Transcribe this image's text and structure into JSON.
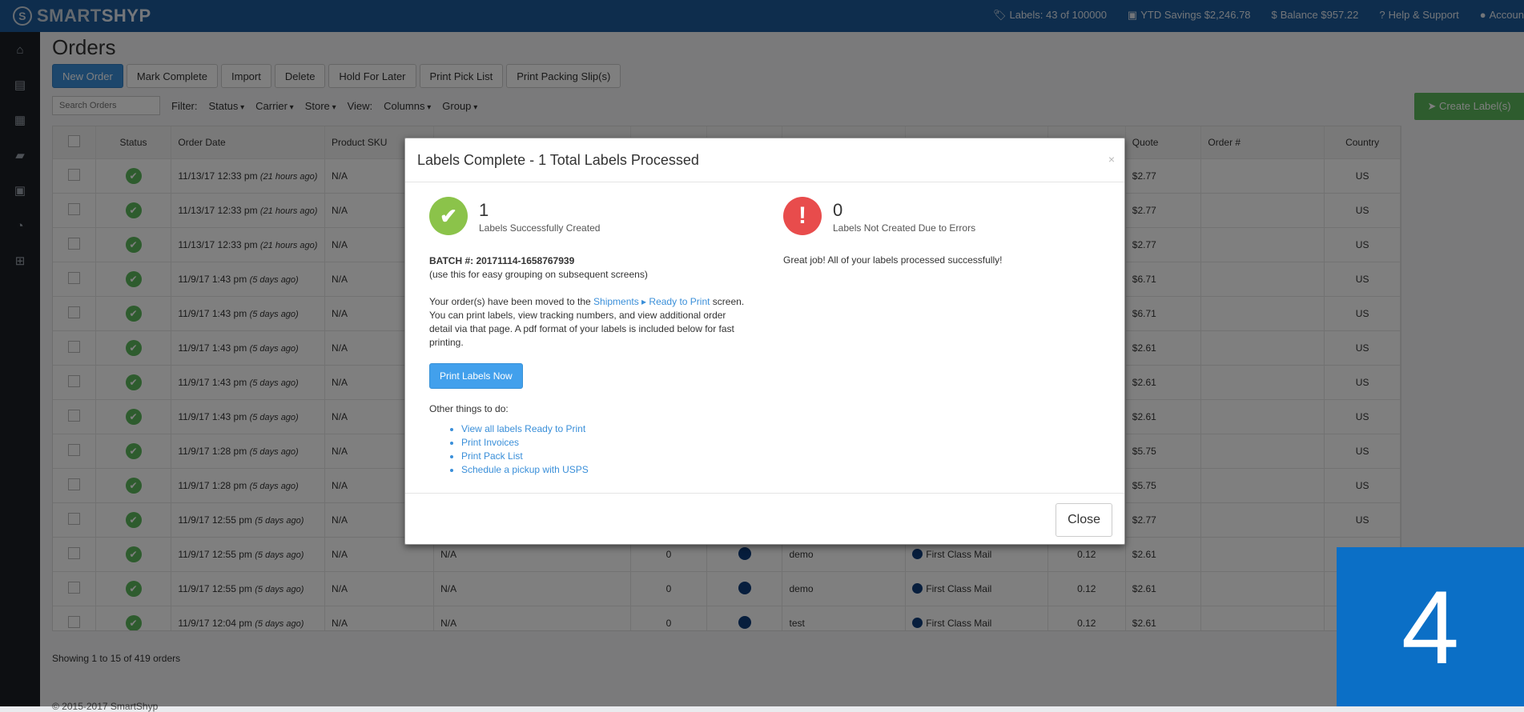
{
  "brand": {
    "part1": "SMART",
    "part2": "SHYP",
    "logo_icon": "S"
  },
  "top_stats": [
    {
      "icon": "tag-icon",
      "glyph": "🏷",
      "text": "Labels: 43 of 100000"
    },
    {
      "icon": "savings-icon",
      "glyph": "▣",
      "text": "YTD Savings $2,246.78"
    },
    {
      "icon": "dollar-icon",
      "glyph": "$",
      "text": "Balance $957.22"
    },
    {
      "icon": "help-icon",
      "glyph": "?",
      "text": "Help & Support"
    },
    {
      "icon": "account-icon",
      "glyph": "●",
      "text": "Accoun"
    }
  ],
  "left_nav": [
    {
      "name": "home-icon",
      "glyph": "⌂"
    },
    {
      "name": "basket-icon",
      "glyph": "▤"
    },
    {
      "name": "calendar-icon",
      "glyph": "▦"
    },
    {
      "name": "truck-icon",
      "glyph": "▰"
    },
    {
      "name": "contact-icon",
      "glyph": "▣"
    },
    {
      "name": "pie-chart-icon",
      "glyph": "◔"
    },
    {
      "name": "cart-icon",
      "glyph": "⊞"
    }
  ],
  "page": {
    "title": "Orders"
  },
  "actions": {
    "new_order": "New Order",
    "mark_complete": "Mark Complete",
    "import": "Import",
    "delete": "Delete",
    "hold": "Hold For Later",
    "pick_list": "Print Pick List",
    "packing_slips": "Print Packing Slip(s)"
  },
  "filters": {
    "search_placeholder": "Search Orders",
    "filter_label": "Filter:",
    "status": "Status",
    "carrier": "Carrier",
    "store": "Store",
    "view_label": "View:",
    "columns": "Columns",
    "group": "Group"
  },
  "create_label": "Create Label(s)",
  "table": {
    "headers": [
      "Status",
      "Order Date",
      "Product SKU",
      "",
      "",
      "",
      "",
      "",
      "Quote",
      "Order #",
      "Country"
    ],
    "rows": [
      {
        "date": "11/13/17 12:33 pm",
        "ago": "(21 hours ago)",
        "sku": "N/A",
        "col4": "",
        "col5": "",
        "store": "",
        "service": "",
        "weight": "",
        "quote": "$2.77",
        "country": "US"
      },
      {
        "date": "11/13/17 12:33 pm",
        "ago": "(21 hours ago)",
        "sku": "N/A",
        "col4": "",
        "col5": "",
        "store": "",
        "service": "",
        "weight": "",
        "quote": "$2.77",
        "country": "US"
      },
      {
        "date": "11/13/17 12:33 pm",
        "ago": "(21 hours ago)",
        "sku": "N/A",
        "col4": "",
        "col5": "",
        "store": "",
        "service": "",
        "weight": "",
        "quote": "$2.77",
        "country": "US"
      },
      {
        "date": "11/9/17 1:43 pm",
        "ago": "(5 days ago)",
        "sku": "N/A",
        "col4": "",
        "col5": "",
        "store": "",
        "service": "",
        "weight": "",
        "quote": "$6.71",
        "country": "US"
      },
      {
        "date": "11/9/17 1:43 pm",
        "ago": "(5 days ago)",
        "sku": "N/A",
        "col4": "",
        "col5": "",
        "store": "",
        "service": "",
        "weight": "",
        "quote": "$6.71",
        "country": "US"
      },
      {
        "date": "11/9/17 1:43 pm",
        "ago": "(5 days ago)",
        "sku": "N/A",
        "col4": "",
        "col5": "",
        "store": "",
        "service": "",
        "weight": "",
        "quote": "$2.61",
        "country": "US"
      },
      {
        "date": "11/9/17 1:43 pm",
        "ago": "(5 days ago)",
        "sku": "N/A",
        "col4": "",
        "col5": "",
        "store": "",
        "service": "",
        "weight": "",
        "quote": "$2.61",
        "country": "US"
      },
      {
        "date": "11/9/17 1:43 pm",
        "ago": "(5 days ago)",
        "sku": "N/A",
        "col4": "",
        "col5": "",
        "store": "",
        "service": "",
        "weight": "",
        "quote": "$2.61",
        "country": "US"
      },
      {
        "date": "11/9/17 1:28 pm",
        "ago": "(5 days ago)",
        "sku": "N/A",
        "col4": "",
        "col5": "",
        "store": "",
        "service": "",
        "weight": "",
        "quote": "$5.75",
        "country": "US"
      },
      {
        "date": "11/9/17 1:28 pm",
        "ago": "(5 days ago)",
        "sku": "N/A",
        "col4": "",
        "col5": "",
        "store": "",
        "service": "",
        "weight": "",
        "quote": "$5.75",
        "country": "US"
      },
      {
        "date": "11/9/17 12:55 pm",
        "ago": "(5 days ago)",
        "sku": "N/A",
        "col4": "",
        "col5": "",
        "store": "",
        "service": "",
        "weight": "",
        "quote": "$2.77",
        "country": "US"
      },
      {
        "date": "11/9/17 12:55 pm",
        "ago": "(5 days ago)",
        "sku": "N/A",
        "col4": "N/A",
        "col5": "0",
        "store": "demo",
        "service": "First Class Mail",
        "weight": "0.12",
        "quote": "$2.61",
        "country": "US"
      },
      {
        "date": "11/9/17 12:55 pm",
        "ago": "(5 days ago)",
        "sku": "N/A",
        "col4": "N/A",
        "col5": "0",
        "store": "demo",
        "service": "First Class Mail",
        "weight": "0.12",
        "quote": "$2.61",
        "country": ""
      },
      {
        "date": "11/9/17 12:04 pm",
        "ago": "(5 days ago)",
        "sku": "N/A",
        "col4": "N/A",
        "col5": "0",
        "store": "test",
        "service": "First Class Mail",
        "weight": "0.12",
        "quote": "$2.61",
        "country": ""
      }
    ]
  },
  "footer": {
    "showing": "Showing 1 to 15 of 419 orders",
    "copyright": "© 2015-2017 SmartShyp"
  },
  "modal": {
    "title": "Labels Complete - 1 Total Labels Processed",
    "close_x": "×",
    "success": {
      "count": "1",
      "label": "Labels Successfully Created",
      "icon": "✔"
    },
    "errors": {
      "count": "0",
      "label": "Labels Not Created Due to Errors",
      "icon": "!"
    },
    "batch_label": "BATCH #:",
    "batch_value": "20171114-1658767939",
    "batch_note": "(use this for easy grouping on subsequent screens)",
    "moved_pre": "Your order(s) have been moved to the ",
    "moved_link1": "Shipments",
    "moved_link2": "Ready to Print",
    "moved_post": " screen. You can print labels, view tracking numbers, and view additional order detail via that page. A pdf format of your labels is included below for fast printing.",
    "print_button": "Print Labels Now",
    "other_title": "Other things to do:",
    "other_links": [
      "View all labels Ready to Print",
      "Print Invoices",
      "Print Pack List",
      "Schedule a pickup with USPS"
    ],
    "great_job": "Great job! All of your labels processed successfully!",
    "close_button": "Close"
  },
  "step_badge": "4"
}
